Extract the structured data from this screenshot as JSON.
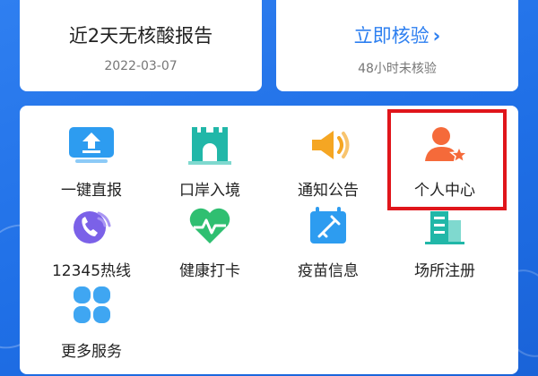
{
  "top_left_card": {
    "title": "近2天无核酸报告",
    "date": "2022-03-07"
  },
  "top_right_card": {
    "link_label": "立即核验",
    "chevron": "›",
    "status": "48小时未核验"
  },
  "services": [
    {
      "label": "一键直报",
      "icon": "upload-icon"
    },
    {
      "label": "口岸入境",
      "icon": "port-gate-icon"
    },
    {
      "label": "通知公告",
      "icon": "speaker-icon"
    },
    {
      "label": "个人中心",
      "icon": "user-star-icon"
    },
    {
      "label": "12345热线",
      "icon": "phone-icon"
    },
    {
      "label": "健康打卡",
      "icon": "heart-pulse-icon"
    },
    {
      "label": "疫苗信息",
      "icon": "vaccine-icon"
    },
    {
      "label": "场所注册",
      "icon": "building-icon"
    },
    {
      "label": "更多服务",
      "icon": "grid-more-icon"
    }
  ],
  "colors": {
    "brand": "#2d7ff0",
    "highlight": "#e0151b",
    "orange": "#f56a3a",
    "green": "#2fbf71"
  }
}
